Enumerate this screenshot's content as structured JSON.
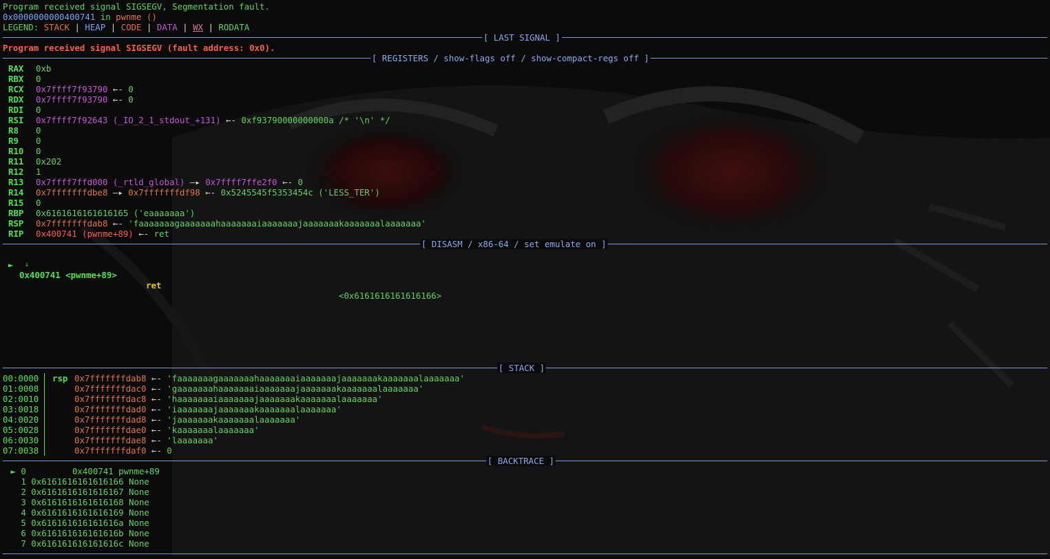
{
  "header": {
    "signal_message": "Program received signal SIGSEGV, Segmentation fault.",
    "fault_addr": "0x0000000000400741",
    "fault_in": " in ",
    "fault_func": "pwnme ()",
    "legend_label": "LEGEND: ",
    "legend": {
      "stack": "STACK",
      "heap": "HEAP",
      "code": "CODE",
      "data": "DATA",
      "wx": "WX",
      "rodata": "RODATA",
      "sep": " | "
    }
  },
  "sections": {
    "last_signal": "[ LAST SIGNAL ]",
    "registers": "[ REGISTERS / show-flags off / show-compact-regs off ]",
    "disasm": "[ DISASM / x86-64 / set emulate on ]",
    "stack": "[ STACK ]",
    "backtrace": "[ BACKTRACE ]"
  },
  "last_signal_text": "Program received signal SIGSEGV (fault address: 0x0).",
  "registers": [
    {
      "name": "RAX",
      "parts": [
        [
          "g",
          "0xb"
        ]
      ]
    },
    {
      "name": "RBX",
      "parts": [
        [
          "g",
          "0"
        ]
      ]
    },
    {
      "name": "RCX",
      "parts": [
        [
          "mag",
          "0x7ffff7f93790"
        ],
        [
          "wht",
          " ←- "
        ],
        [
          "g",
          "0"
        ]
      ]
    },
    {
      "name": "RDX",
      "parts": [
        [
          "mag",
          "0x7ffff7f93790"
        ],
        [
          "wht",
          " ←- "
        ],
        [
          "g",
          "0"
        ]
      ]
    },
    {
      "name": "RDI",
      "parts": [
        [
          "g",
          "0"
        ]
      ]
    },
    {
      "name": "RSI",
      "parts": [
        [
          "mag",
          "0x7ffff7f92643 (_IO_2_1_stdout_+131)"
        ],
        [
          "wht",
          " ←- "
        ],
        [
          "g",
          "0xf93790000000000a /* '\\n' */"
        ]
      ]
    },
    {
      "name": "R8",
      "parts": [
        [
          "g",
          "0"
        ]
      ]
    },
    {
      "name": "R9",
      "parts": [
        [
          "g",
          "0"
        ]
      ]
    },
    {
      "name": "R10",
      "parts": [
        [
          "g",
          "0"
        ]
      ]
    },
    {
      "name": "R11",
      "parts": [
        [
          "g",
          "0x202"
        ]
      ]
    },
    {
      "name": "R12",
      "parts": [
        [
          "g",
          "1"
        ]
      ]
    },
    {
      "name": "R13",
      "parts": [
        [
          "mag",
          "0x7ffff7ffd000 (_rtld_global)"
        ],
        [
          "wht",
          " —▸ "
        ],
        [
          "mag",
          "0x7ffff7ffe2f0"
        ],
        [
          "wht",
          " ←- "
        ],
        [
          "g",
          "0"
        ]
      ]
    },
    {
      "name": "R14",
      "parts": [
        [
          "ora",
          "0x7fffffffdbe8"
        ],
        [
          "wht",
          " —▸ "
        ],
        [
          "ora",
          "0x7fffffffdf98"
        ],
        [
          "wht",
          " ←- "
        ],
        [
          "g",
          "0x5245545f5353454c ('LESS_TER')"
        ]
      ]
    },
    {
      "name": "R15",
      "parts": [
        [
          "g",
          "0"
        ]
      ]
    },
    {
      "name": "RBP",
      "parts": [
        [
          "g",
          "0x6161616161616165 ('eaaaaaaa')"
        ]
      ]
    },
    {
      "name": "RSP",
      "parts": [
        [
          "ora",
          "0x7fffffffdab8"
        ],
        [
          "wht",
          " ←- "
        ],
        [
          "g",
          "'faaaaaaagaaaaaaahaaaaaaaiaaaaaaajaaaaaaakaaaaaaalaaaaaaa'"
        ]
      ]
    },
    {
      "name": "RIP",
      "parts": [
        [
          "red",
          "0x400741 (pwnme+89)"
        ],
        [
          "wht",
          " ←- "
        ],
        [
          "g",
          "ret"
        ]
      ]
    }
  ],
  "disasm": {
    "marker": "►",
    "address": "0x400741 <pwnme+89>",
    "mnemonic": "ret",
    "target": "<0x6161616161616166>",
    "down_arrow": "↓"
  },
  "stack": [
    {
      "index": "00:0000",
      "reg": "rsp",
      "addr": "0x7fffffffdab8",
      "arrow": " ←- ",
      "value": "'faaaaaaagaaaaaaahaaaaaaaiaaaaaaajaaaaaaakaaaaaaalaaaaaaa'"
    },
    {
      "index": "01:0008",
      "reg": "",
      "addr": "0x7fffffffdac0",
      "arrow": " ←- ",
      "value": "'gaaaaaaahaaaaaaaiaaaaaaajaaaaaaakaaaaaaalaaaaaaa'"
    },
    {
      "index": "02:0010",
      "reg": "",
      "addr": "0x7fffffffdac8",
      "arrow": " ←- ",
      "value": "'haaaaaaaiaaaaaaajaaaaaaakaaaaaaalaaaaaaa'"
    },
    {
      "index": "03:0018",
      "reg": "",
      "addr": "0x7fffffffdad0",
      "arrow": " ←- ",
      "value": "'iaaaaaaajaaaaaaakaaaaaaalaaaaaaa'"
    },
    {
      "index": "04:0020",
      "reg": "",
      "addr": "0x7fffffffdad8",
      "arrow": " ←- ",
      "value": "'jaaaaaaakaaaaaaalaaaaaaa'"
    },
    {
      "index": "05:0028",
      "reg": "",
      "addr": "0x7fffffffdae0",
      "arrow": " ←- ",
      "value": "'kaaaaaaalaaaaaaa'"
    },
    {
      "index": "06:0030",
      "reg": "",
      "addr": "0x7fffffffdae8",
      "arrow": " ←- ",
      "value": "'laaaaaaa'"
    },
    {
      "index": "07:0038",
      "reg": "",
      "addr": "0x7fffffffdaf0",
      "arrow": " ←- ",
      "value": "0"
    }
  ],
  "backtrace": [
    {
      "text": " ► 0         0x400741 pwnme+89"
    },
    {
      "text": "   1 0x6161616161616166 None"
    },
    {
      "text": "   2 0x6161616161616167 None"
    },
    {
      "text": "   3 0x6161616161616168 None"
    },
    {
      "text": "   4 0x6161616161616169 None"
    },
    {
      "text": "   5 0x616161616161616a None"
    },
    {
      "text": "   6 0x616161616161616b None"
    },
    {
      "text": "   7 0x616161616161616c None"
    }
  ],
  "colors": {
    "background": "#0b0b0b",
    "separator": "#7f9ad8",
    "green": "#5fd35f",
    "bright_green": "#4ee34e",
    "red": "#ff5a4a",
    "blue": "#7aa2f7",
    "orange": "#e0743c",
    "magenta": "#c455d8",
    "yellow": "#e5c400"
  }
}
